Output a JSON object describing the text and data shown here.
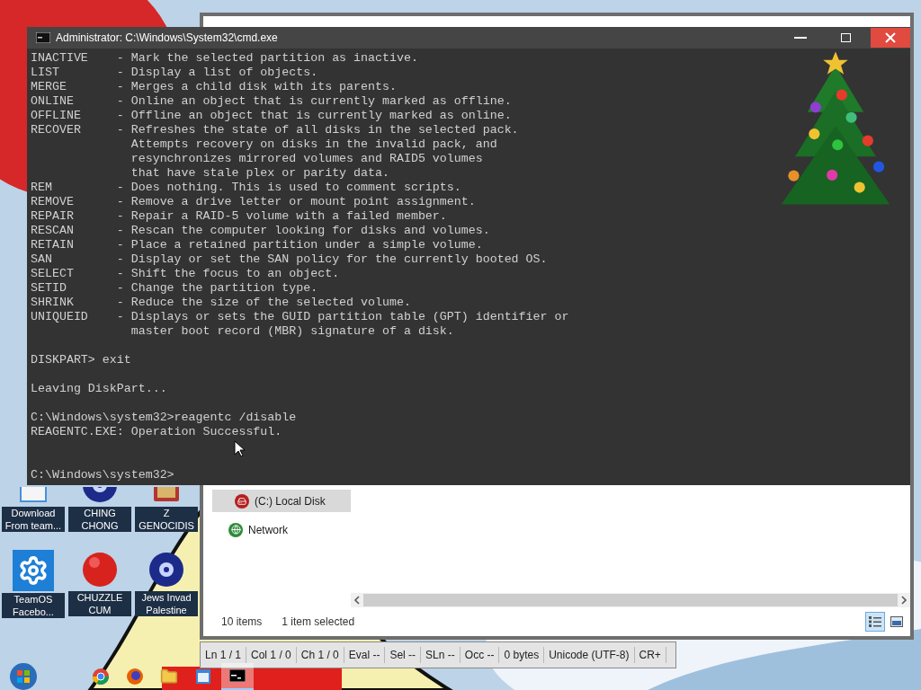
{
  "desktop_icons": [
    {
      "label": "Download From team...",
      "kind": "document"
    },
    {
      "label": "CHING CHONG",
      "kind": "disc"
    },
    {
      "label": "Z GENOCIDIS",
      "kind": "book"
    },
    {
      "label": "TeamOS Facebo...",
      "kind": "gear"
    },
    {
      "label": "CHUZZLE CUM",
      "kind": "fuzzball"
    },
    {
      "label": "Jews Invad Palestine",
      "kind": "disc"
    }
  ],
  "explorer": {
    "nav_items": [
      {
        "label": "(C:) Local Disk",
        "kind": "drive",
        "selected": true
      },
      {
        "label": "Network",
        "kind": "network",
        "selected": false
      }
    ],
    "status": {
      "item_count": "10 items",
      "selection": "1 item selected"
    },
    "view_buttons": [
      {
        "kind": "details",
        "selected": true
      },
      {
        "kind": "preview",
        "selected": false
      }
    ]
  },
  "editor_status_bar": [
    "Ln 1 / 1",
    "Col 1 / 0",
    "Ch 1 / 0",
    "Eval --",
    "Sel --",
    "SLn --",
    "Occ --",
    "0 bytes",
    "Unicode (UTF-8)",
    "CR+"
  ],
  "cmd": {
    "title": "Administrator: C:\\Windows\\System32\\cmd.exe",
    "lines": [
      {
        "kind": "text",
        "text": "INACTIVE    - Mark the selected partition as inactive."
      },
      {
        "kind": "text",
        "text": "LIST        - Display a list of objects."
      },
      {
        "kind": "text",
        "text": "MERGE       - Merges a child disk with its parents."
      },
      {
        "kind": "text",
        "text": "ONLINE      - Online an object that is currently marked as offline."
      },
      {
        "kind": "text",
        "text": "OFFLINE     - Offline an object that is currently marked as online."
      },
      {
        "kind": "text",
        "text": "RECOVER     - Refreshes the state of all disks in the selected pack."
      },
      {
        "kind": "text",
        "text": "              Attempts recovery on disks in the invalid pack, and"
      },
      {
        "kind": "text",
        "text": "              resynchronizes mirrored volumes and RAID5 volumes"
      },
      {
        "kind": "text",
        "text": "              that have stale plex or parity data."
      },
      {
        "kind": "text",
        "text": "REM         - Does nothing. This is used to comment scripts."
      },
      {
        "kind": "text",
        "text": "REMOVE      - Remove a drive letter or mount point assignment."
      },
      {
        "kind": "text",
        "text": "REPAIR      - Repair a RAID-5 volume with a failed member."
      },
      {
        "kind": "text",
        "text": "RESCAN      - Rescan the computer looking for disks and volumes."
      },
      {
        "kind": "text",
        "text": "RETAIN      - Place a retained partition under a simple volume."
      },
      {
        "kind": "text",
        "text": "SAN         - Display or set the SAN policy for the currently booted OS."
      },
      {
        "kind": "text",
        "text": "SELECT      - Shift the focus to an object."
      },
      {
        "kind": "text",
        "text": "SETID       - Change the partition type."
      },
      {
        "kind": "text",
        "text": "SHRINK      - Reduce the size of the selected volume."
      },
      {
        "kind": "text",
        "text": "UNIQUEID    - Displays or sets the GUID partition table (GPT) identifier or"
      },
      {
        "kind": "text",
        "text": "              master boot record (MBR) signature of a disk."
      },
      {
        "kind": "blank"
      },
      {
        "kind": "text",
        "text": "DISKPART> exit"
      },
      {
        "kind": "blank"
      },
      {
        "kind": "text",
        "text": "Leaving DiskPart..."
      },
      {
        "kind": "blank"
      },
      {
        "kind": "text",
        "text": "C:\\Windows\\system32>reagentc /disable"
      },
      {
        "kind": "text",
        "text": "REAGENTC.EXE: Operation Successful."
      },
      {
        "kind": "blank"
      },
      {
        "kind": "blank"
      },
      {
        "kind": "text",
        "text": "C:\\Windows\\system32>"
      }
    ]
  },
  "taskbar": [
    {
      "kind": "start",
      "active": false
    },
    {
      "kind": "browser",
      "active": false
    },
    {
      "kind": "fox",
      "active": false
    },
    {
      "kind": "folder",
      "active": false
    },
    {
      "kind": "window",
      "active": false
    },
    {
      "kind": "terminal",
      "active": true
    }
  ]
}
